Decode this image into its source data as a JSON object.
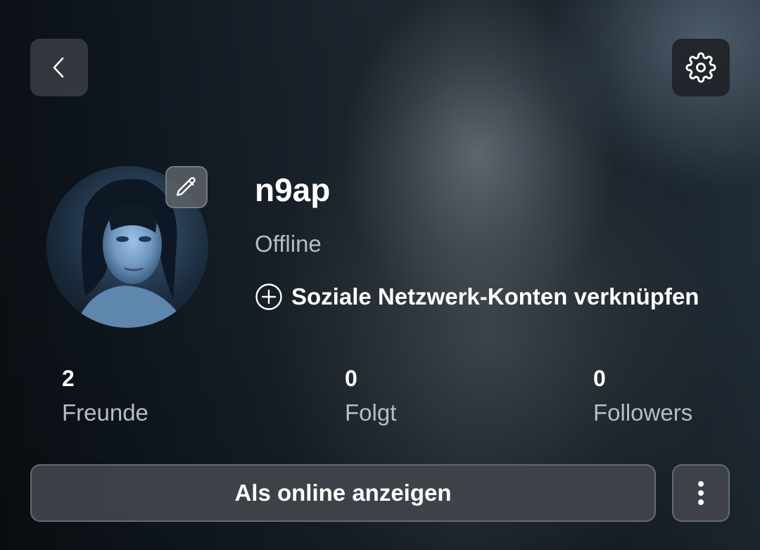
{
  "profile": {
    "username": "n9ap",
    "status": "Offline",
    "link_social_label": "Soziale Netzwerk-Konten verknüpfen"
  },
  "stats": [
    {
      "value": "2",
      "label": "Freunde"
    },
    {
      "value": "0",
      "label": "Folgt"
    },
    {
      "value": "0",
      "label": "Followers"
    }
  ],
  "actions": {
    "show_online_label": "Als online anzeigen"
  },
  "icons": {
    "back": "chevron-left-icon",
    "settings": "gear-icon",
    "edit": "pencil-icon",
    "add": "plus-circle-icon",
    "more": "vertical-ellipsis-icon"
  }
}
